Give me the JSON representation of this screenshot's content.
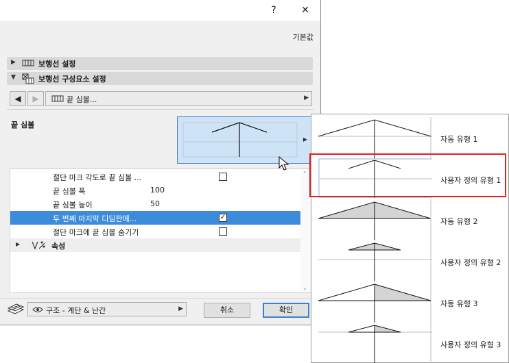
{
  "titlebar": {
    "help_label": "?",
    "close_label": "✕"
  },
  "defaults_label": "기본값",
  "sections": {
    "railing_settings": {
      "label": "보행선 설정"
    },
    "component_settings": {
      "label": "보행선 구성요소 설정"
    }
  },
  "nav": {
    "prev_label": "◀",
    "next_label": "▶",
    "current": "끝 심볼..."
  },
  "end_symbol_label": "끝 심볼",
  "properties": [
    {
      "label": "절단 마크 각도로 끝 심볼 ...",
      "checked": false
    },
    {
      "label": "끝 심볼 폭",
      "value": "100"
    },
    {
      "label": "끝 심볼 높이",
      "value": "50"
    },
    {
      "label": "두 번째 마지막 디딤판에...",
      "checked": true,
      "selected": true
    },
    {
      "label": "절단 마크에 끝 심볼 숨기기",
      "checked": false
    }
  ],
  "property_category": {
    "label": "속성"
  },
  "footer": {
    "layer_value": "구조 - 계단 & 난간",
    "cancel_label": "취소",
    "ok_label": "확인"
  },
  "popup_options": [
    {
      "label": "자동 유형 1"
    },
    {
      "label": "사용자 정의 유형 1",
      "selected": true
    },
    {
      "label": "자동 유형 2"
    },
    {
      "label": "사용자 정의 유형 2"
    },
    {
      "label": "자동 유형 3"
    },
    {
      "label": "사용자 정의 유형 3"
    }
  ],
  "colors": {
    "selection_blue": "#3c8cdb",
    "preview_bg": "#cfe3f7",
    "highlight_red": "#e01e1e",
    "symbol_fill": "#d4d4d4"
  },
  "icons": {
    "railing_settings": "railing-icon",
    "component_settings": "railing-component-icon",
    "nav_item": "railing-icon",
    "category": "properties-icon",
    "layer": "layer-icon",
    "visibility": "eye-icon"
  }
}
